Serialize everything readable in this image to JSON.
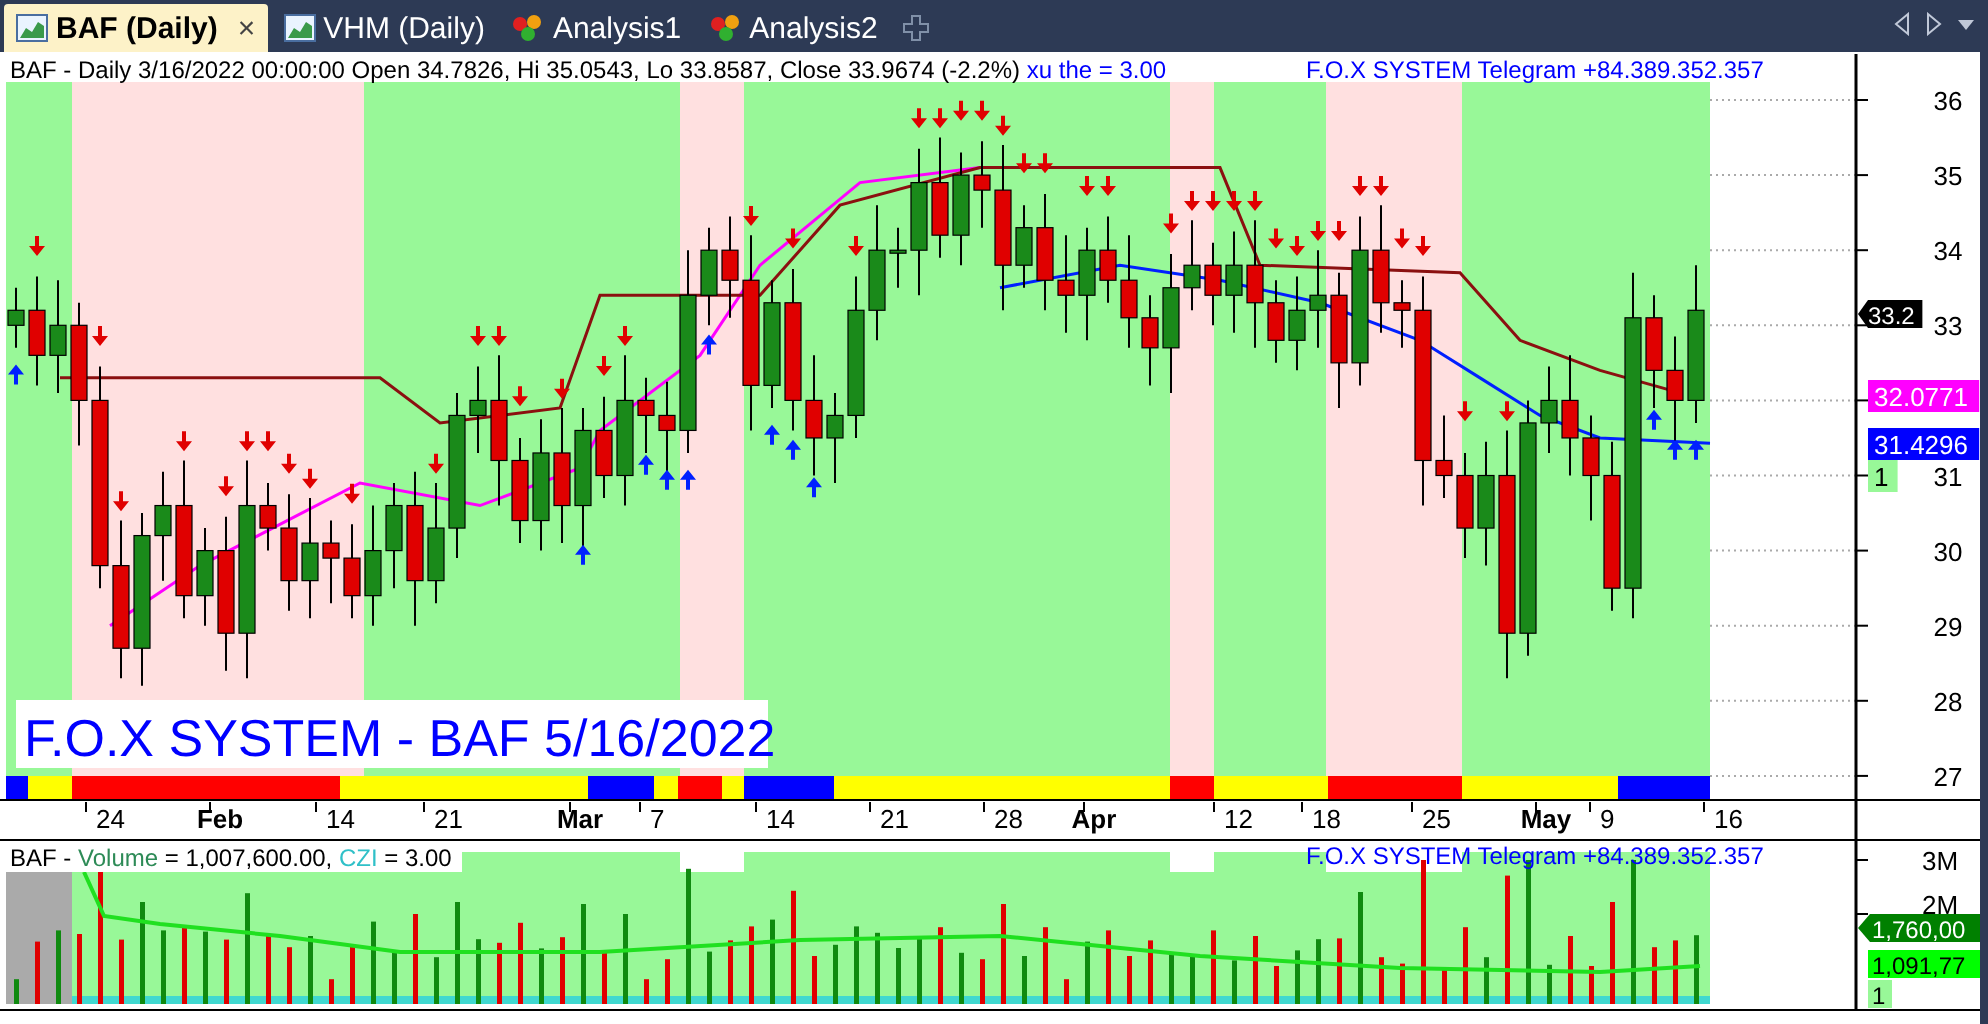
{
  "tabs": [
    {
      "label": "BAF (Daily)",
      "kind": "chart",
      "selected": true,
      "close": "×"
    },
    {
      "label": "VHM (Daily)",
      "kind": "chart",
      "selected": false
    },
    {
      "label": "Analysis1",
      "kind": "analysis",
      "selected": false
    },
    {
      "label": "Analysis2",
      "kind": "analysis",
      "selected": false
    }
  ],
  "price_pane": {
    "title": "BAF - Daily 3/16/2022 00:00:00 Open 34.7826, Hi 35.0543, Lo 33.8587, Close 33.9674 (-2.2%)",
    "indicator": "xu the = 3.00",
    "telegram": "F.O.X SYSTEM Telegram +84.389.352.357",
    "overlay_title": "F.O.X SYSTEM - BAF 5/16/2022",
    "y_ticks_upper": [
      "36",
      "35",
      "34",
      "33"
    ],
    "y_ticks_lower": [
      "31",
      "30",
      "29",
      "28",
      "27"
    ],
    "tags": [
      {
        "text": "33.2",
        "color": "#000000"
      },
      {
        "text": "32.0771",
        "color": "#ff00ff"
      },
      {
        "text": "31.4296",
        "color": "#0000ff"
      },
      {
        "text": "1",
        "color": "#98f898"
      }
    ]
  },
  "x_ticks": [
    {
      "label": "24",
      "bold": false
    },
    {
      "label": "Feb",
      "bold": true
    },
    {
      "label": "14",
      "bold": false
    },
    {
      "label": "21",
      "bold": false
    },
    {
      "label": "Mar",
      "bold": true
    },
    {
      "label": "7",
      "bold": false
    },
    {
      "label": "14",
      "bold": false
    },
    {
      "label": "21",
      "bold": false
    },
    {
      "label": "28",
      "bold": false
    },
    {
      "label": "Apr",
      "bold": true
    },
    {
      "label": "12",
      "bold": false
    },
    {
      "label": "18",
      "bold": false
    },
    {
      "label": "25",
      "bold": false
    },
    {
      "label": "May",
      "bold": true
    },
    {
      "label": "9",
      "bold": false
    },
    {
      "label": "16",
      "bold": false
    }
  ],
  "volume_pane": {
    "title_prefix": "BAF - ",
    "volume_label": "Volume",
    "volume_value": " = 1,007,600.00, ",
    "czi_label": "CZI",
    "czi_value": " = 3.00",
    "telegram": "F.O.X SYSTEM Telegram +84.389.352.357",
    "y_ticks": [
      "3M",
      "2M"
    ],
    "tags": [
      {
        "text": "1,760,00",
        "color": "#008000"
      },
      {
        "text": "1,091,77",
        "color": "#00ff00"
      },
      {
        "text": "1",
        "color": "#98f898"
      }
    ]
  }
}
